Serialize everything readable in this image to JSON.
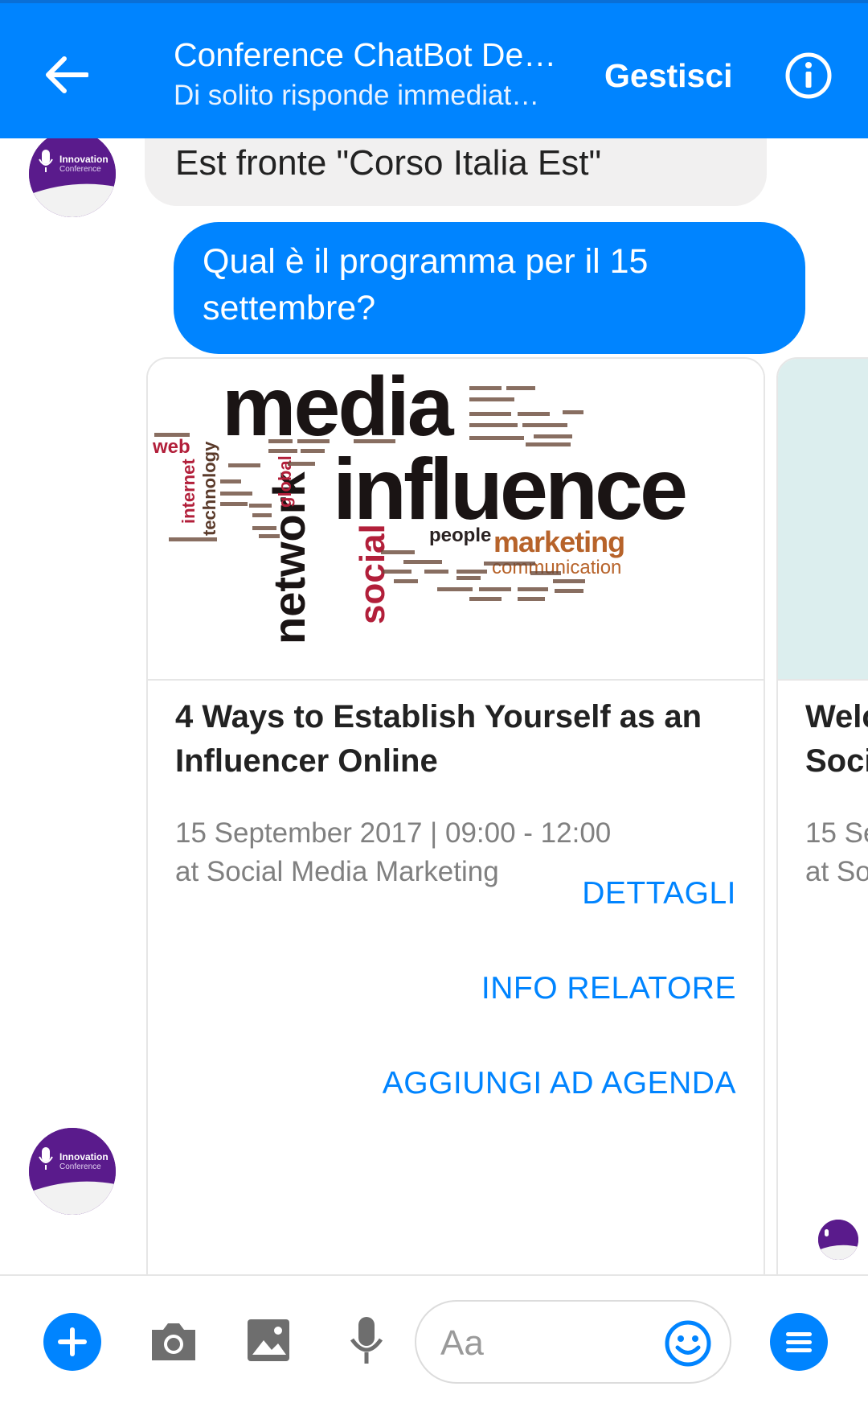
{
  "header": {
    "title": "Conference ChatBot De…",
    "subtitle": "Di solito risponde immediat…",
    "manage_label": "Gestisci"
  },
  "avatar": {
    "line1": "Innovation",
    "line2": "Conference"
  },
  "messages": {
    "incoming_text": "Est fronte \"Corso Italia Est\"",
    "outgoing_text": "Qual è il programma per il 15 settembre?"
  },
  "cards": [
    {
      "image_words": {
        "media": "media",
        "influence": "influence",
        "network": "network",
        "social": "social",
        "marketing": "marketing",
        "people": "people",
        "communication": "communication",
        "web": "web",
        "internet": "internet",
        "technology": "technology",
        "global": "global"
      },
      "title": "4 Ways to Establish Yourself as an Influencer Online",
      "date_time": "15 September 2017 | 09:00 - 12:00",
      "location": "at Social Media Marketing",
      "buttons": {
        "details": "DETTAGLI",
        "speaker_info": "INFO RELATORE",
        "add_to_agenda": "AGGIUNGI AD AGENDA"
      }
    },
    {
      "title_partial": "Welc",
      "title_partial2": "Soci",
      "date_partial": "15 Se",
      "location_partial": "at So"
    }
  ],
  "composer": {
    "placeholder": "Aa"
  },
  "colors": {
    "brand_blue": "#0084ff",
    "avatar_purple": "#5a1b8c"
  }
}
